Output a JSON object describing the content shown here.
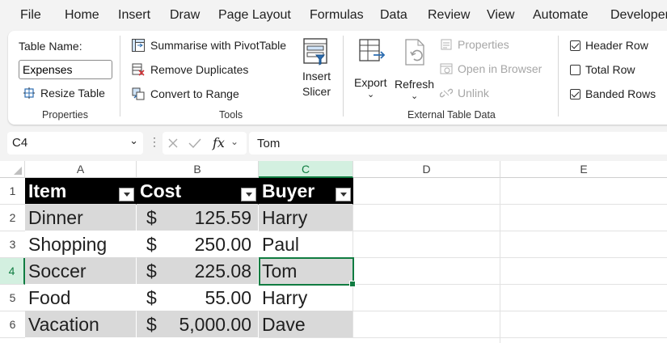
{
  "menu": [
    "File",
    "Home",
    "Insert",
    "Draw",
    "Page Layout",
    "Formulas",
    "Data",
    "Review",
    "View",
    "Automate",
    "Developer"
  ],
  "ribbon": {
    "properties": {
      "table_name_label": "Table Name:",
      "table_name_value": "Expenses",
      "resize_label": "Resize Table",
      "group_label": "Properties"
    },
    "tools": {
      "summarise_label": "Summarise with PivotTable",
      "remove_dupes_label": "Remove Duplicates",
      "convert_label": "Convert to Range",
      "group_label": "Tools"
    },
    "slicer": {
      "line1": "Insert",
      "line2": "Slicer"
    },
    "external": {
      "export_label": "Export",
      "refresh_label": "Refresh",
      "properties_label": "Properties",
      "open_browser_label": "Open in Browser",
      "unlink_label": "Unlink",
      "group_label": "External Table Data"
    },
    "style_options": {
      "header_row": {
        "label": "Header Row",
        "checked": true
      },
      "total_row": {
        "label": "Total Row",
        "checked": false
      },
      "banded_rows": {
        "label": "Banded Rows",
        "checked": true
      }
    }
  },
  "formula_bar": {
    "name_box": "C4",
    "fx": "fx",
    "value": "Tom"
  },
  "sheet": {
    "columns": [
      "A",
      "B",
      "C",
      "D",
      "E"
    ],
    "rows": [
      "1",
      "2",
      "3",
      "4",
      "5",
      "6"
    ],
    "header": {
      "item": "Item",
      "cost": "Cost",
      "buyer": "Buyer"
    },
    "data": [
      {
        "item": "Dinner",
        "currency": "$",
        "cost": "125.59",
        "buyer": "Harry"
      },
      {
        "item": "Shopping",
        "currency": "$",
        "cost": "250.00",
        "buyer": "Paul"
      },
      {
        "item": "Soccer",
        "currency": "$",
        "cost": "225.08",
        "buyer": "Tom"
      },
      {
        "item": "Food",
        "currency": "$",
        "cost": "55.00",
        "buyer": "Harry"
      },
      {
        "item": "Vacation",
        "currency": "$",
        "cost": "5,000.00",
        "buyer": "Dave"
      }
    ]
  },
  "colors": {
    "excel_green": "#107c41",
    "band": "#d9d9d9",
    "header_bg": "#000000"
  }
}
